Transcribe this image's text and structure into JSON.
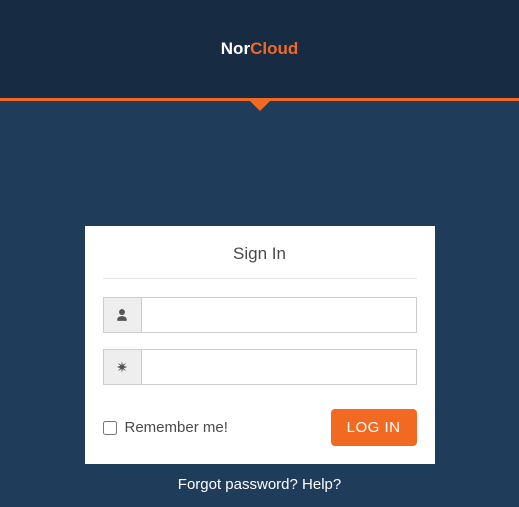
{
  "brand": {
    "part1": "Nor",
    "part2": "Cloud"
  },
  "card": {
    "title": "Sign In",
    "remember_label": "Remember me!",
    "login_button": "LOG IN"
  },
  "inputs": {
    "username_value": "",
    "username_placeholder": "",
    "password_value": "",
    "password_placeholder": ""
  },
  "footer": {
    "forgot": "Forgot password?",
    "help": "Help?"
  },
  "colors": {
    "accent": "#f26a21",
    "header_bg": "#172b42",
    "page_bg": "#203c5b"
  }
}
